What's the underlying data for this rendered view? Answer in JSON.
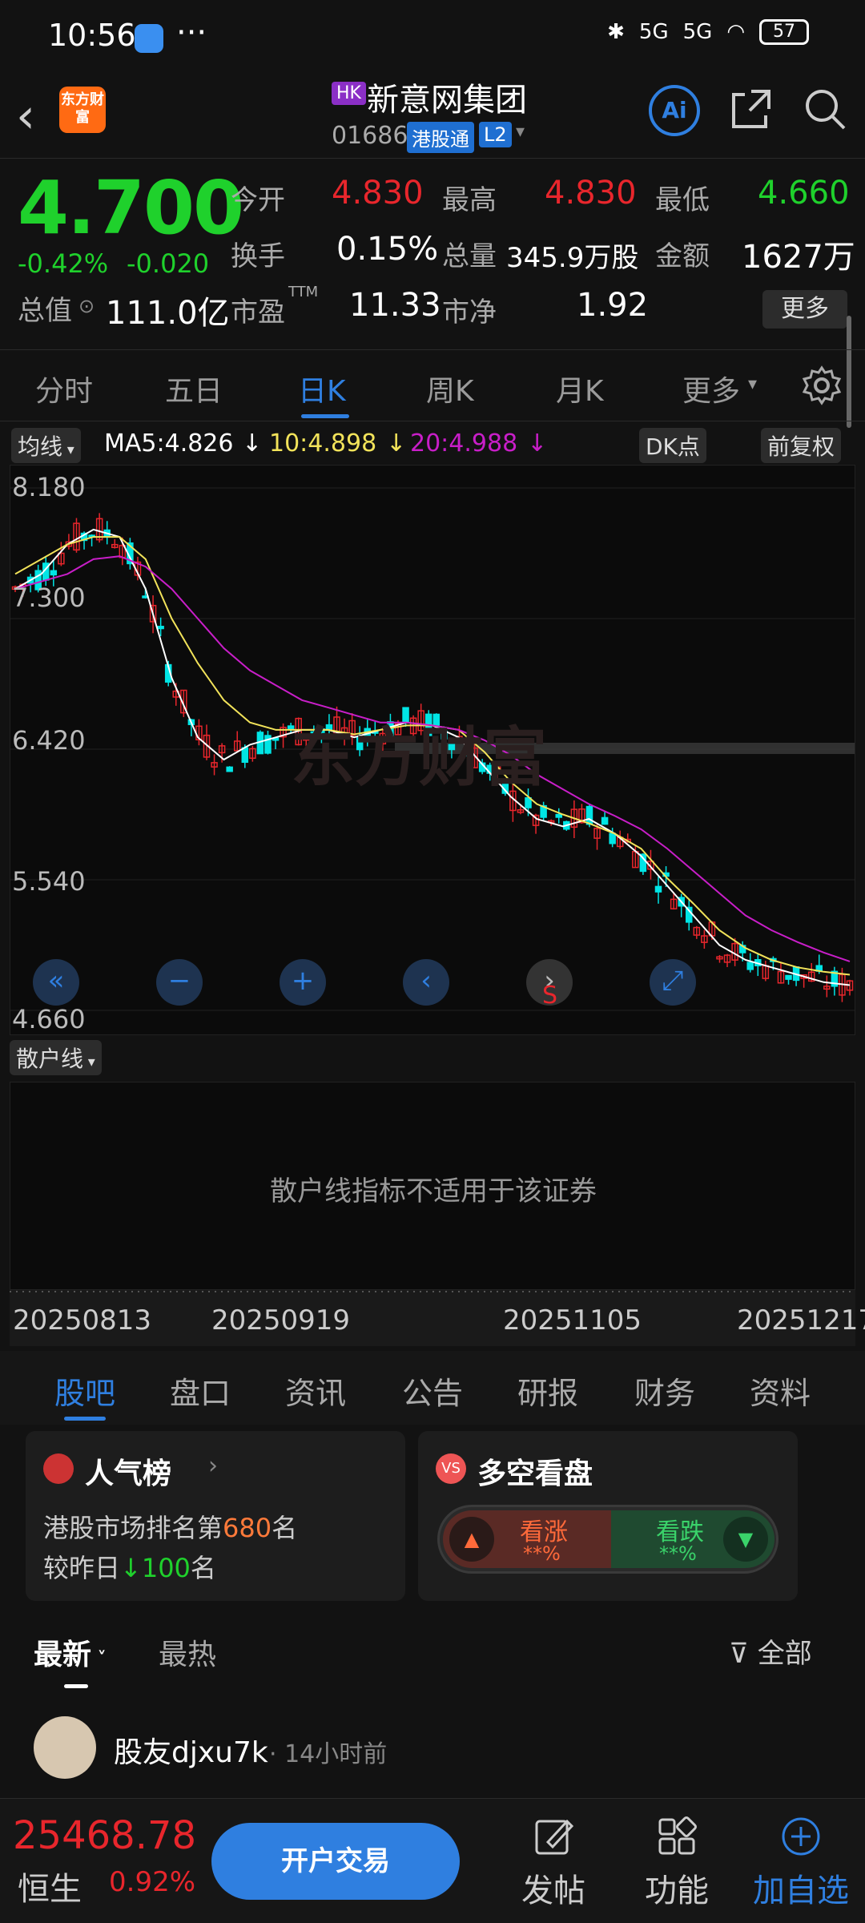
{
  "status": {
    "time": "10:56",
    "battery": "57",
    "signal": "5G"
  },
  "header": {
    "logo_text": "东方财富",
    "market_tag": "HK",
    "name": "新意网集团",
    "code": "01686",
    "tag_hk_connect": "港股通",
    "tag_level": "L2",
    "ai_label": "Ai"
  },
  "quote": {
    "price": "4.700",
    "change_pct": "-0.42%",
    "change_abs": "-0.020",
    "open_label": "今开",
    "open": "4.830",
    "high_label": "最高",
    "high": "4.830",
    "low_label": "最低",
    "low": "4.660",
    "turnover_label": "换手",
    "turnover": "0.15%",
    "volume_label": "总量",
    "volume": "345.9万股",
    "amount_label": "金额",
    "amount": "1627万",
    "mktcap_label": "总值",
    "mktcap": "111.0亿",
    "pe_label": "市盈",
    "pe_sup": "TTM",
    "pe": "11.33",
    "pb_label": "市净",
    "pb": "1.92",
    "more": "更多"
  },
  "period_tabs": [
    "分时",
    "五日",
    "日K",
    "周K",
    "月K",
    "更多"
  ],
  "period_active": 2,
  "chart_legend": {
    "indicator": "均线",
    "ma5": "MA5:4.826",
    "ma10": "10:4.898",
    "ma20": "20:4.988",
    "dk_button": "DK点",
    "adjust_button": "前复权"
  },
  "colors": {
    "up": "#e8262c",
    "down": "#1fd12c",
    "accent": "#2f7fe0",
    "candle_down": "#00e5e5",
    "ma5": "#ffffff",
    "ma10": "#f2e35a",
    "ma20": "#c81ec8"
  },
  "chart_data": {
    "type": "line",
    "y_ticks": [
      "8.180",
      "7.300",
      "6.420",
      "5.540",
      "4.660"
    ],
    "ylim": [
      4.66,
      8.18
    ],
    "x_ticks": [
      "20250813",
      "20250919",
      "20251105",
      "20251217"
    ],
    "watermark": "东方财富",
    "series": [
      {
        "name": "MA5",
        "values": [
          7.5,
          7.6,
          7.8,
          7.9,
          7.85,
          7.5,
          6.9,
          6.5,
          6.35,
          6.45,
          6.5,
          6.55,
          6.55,
          6.5,
          6.55,
          6.6,
          6.58,
          6.5,
          6.3,
          6.1,
          5.95,
          5.9,
          5.95,
          5.85,
          5.7,
          5.5,
          5.3,
          5.1,
          5.0,
          4.95,
          4.9,
          4.85,
          4.83
        ]
      },
      {
        "name": "MA10",
        "values": [
          7.6,
          7.7,
          7.8,
          7.85,
          7.85,
          7.7,
          7.3,
          7.0,
          6.75,
          6.6,
          6.55,
          6.55,
          6.55,
          6.52,
          6.55,
          6.58,
          6.58,
          6.55,
          6.4,
          6.2,
          6.05,
          5.98,
          5.92,
          5.85,
          5.75,
          5.55,
          5.38,
          5.2,
          5.08,
          5.0,
          4.95,
          4.92,
          4.9
        ]
      },
      {
        "name": "MA20",
        "values": [
          7.5,
          7.55,
          7.6,
          7.7,
          7.72,
          7.65,
          7.5,
          7.3,
          7.1,
          6.95,
          6.85,
          6.75,
          6.7,
          6.65,
          6.6,
          6.6,
          6.58,
          6.55,
          6.48,
          6.38,
          6.25,
          6.15,
          6.05,
          5.97,
          5.88,
          5.75,
          5.6,
          5.45,
          5.3,
          5.2,
          5.12,
          5.05,
          4.99
        ]
      }
    ]
  },
  "chart_controls": [
    "«",
    "−",
    "+",
    "‹",
    "›",
    "⤢"
  ],
  "chart_overlay_s": "S",
  "sub_indicator": {
    "label": "散户线",
    "message": "散户线指标不适用于该证券"
  },
  "info_tabs": [
    "股吧",
    "盘口",
    "资讯",
    "公告",
    "研报",
    "财务",
    "资料"
  ],
  "info_active": 0,
  "popularity": {
    "title": "人气榜",
    "rank_prefix": "港股市场排名第",
    "rank": "680",
    "rank_suffix": "名",
    "cmp_prefix": "较昨日",
    "cmp_value": "100",
    "cmp_suffix": "名"
  },
  "sentiment": {
    "title": "多空看盘",
    "bull_label": "看涨",
    "bull_value": "**%",
    "bear_label": "看跌",
    "bear_value": "**%"
  },
  "sort": {
    "latest": "最新",
    "hot": "最热",
    "filter": "全部"
  },
  "post": {
    "user": "股友djxu7k",
    "time": "14小时前"
  },
  "bottom": {
    "index_value": "25468.78",
    "index_name": "恒生",
    "index_pct": "0.92%",
    "trade": "开户交易",
    "post": "发帖",
    "tools": "功能",
    "add_watch": "加自选"
  }
}
